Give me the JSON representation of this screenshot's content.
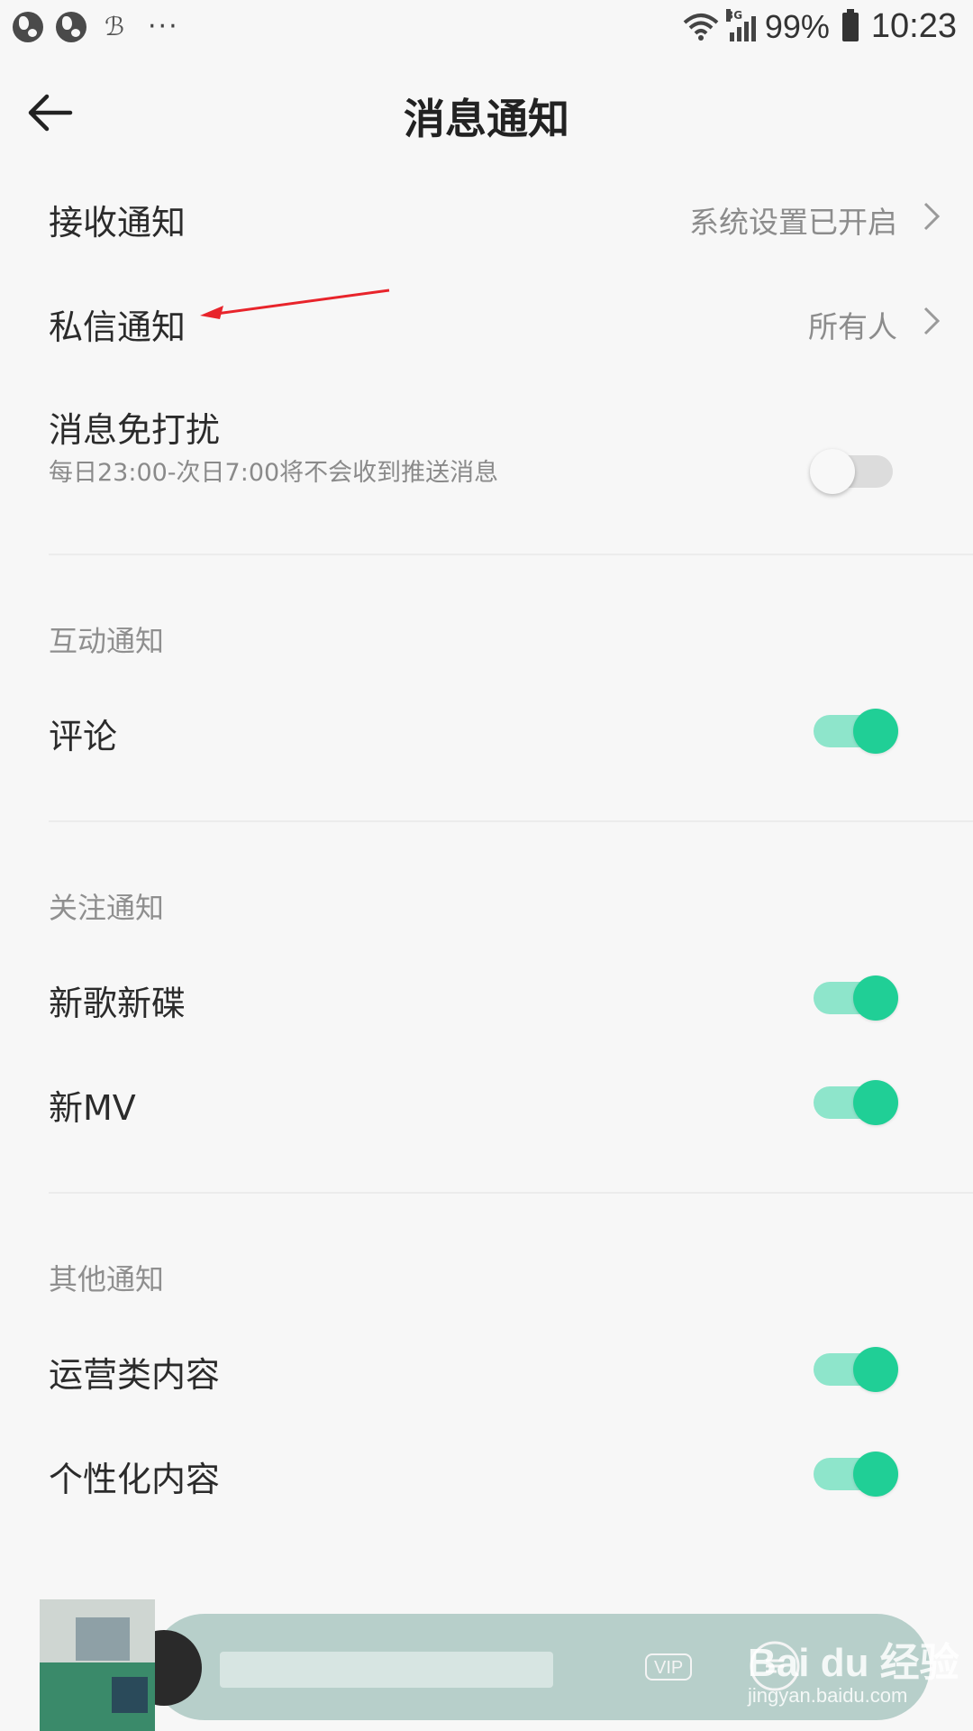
{
  "status_bar": {
    "left_icons": [
      "globe-icon",
      "globe-icon",
      "app-icon"
    ],
    "more": "···",
    "network": "3G",
    "battery": "99%",
    "time": "10:23"
  },
  "header": {
    "title": "消息通知",
    "back_icon": "arrow-left-icon"
  },
  "main_settings": [
    {
      "label": "接收通知",
      "value": "系统设置已开启",
      "type": "link"
    },
    {
      "label": "私信通知",
      "value": "所有人",
      "type": "link"
    },
    {
      "label": "消息免打扰",
      "subtitle": "每日23:00-次日7:00将不会收到推送消息",
      "type": "toggle",
      "on": false
    }
  ],
  "sections": [
    {
      "title": "互动通知",
      "items": [
        {
          "label": "评论",
          "on": true
        }
      ]
    },
    {
      "title": "关注通知",
      "items": [
        {
          "label": "新歌新碟",
          "on": true
        },
        {
          "label": "新MV",
          "on": true
        }
      ]
    },
    {
      "title": "其他通知",
      "items": [
        {
          "label": "运营类内容",
          "on": true
        },
        {
          "label": "个性化内容",
          "on": true
        }
      ]
    }
  ],
  "player": {
    "vip_badge": "VIP"
  },
  "watermark": {
    "text": "Bai du 经验",
    "url": "jingyan.baidu.com"
  },
  "colors": {
    "toggle_on_track": "#8ee5cb",
    "toggle_on_knob": "#20cf96",
    "toggle_off_track": "#dcdcdc",
    "annotation_arrow": "#e8242b",
    "player_bar": "#b7cfca"
  }
}
